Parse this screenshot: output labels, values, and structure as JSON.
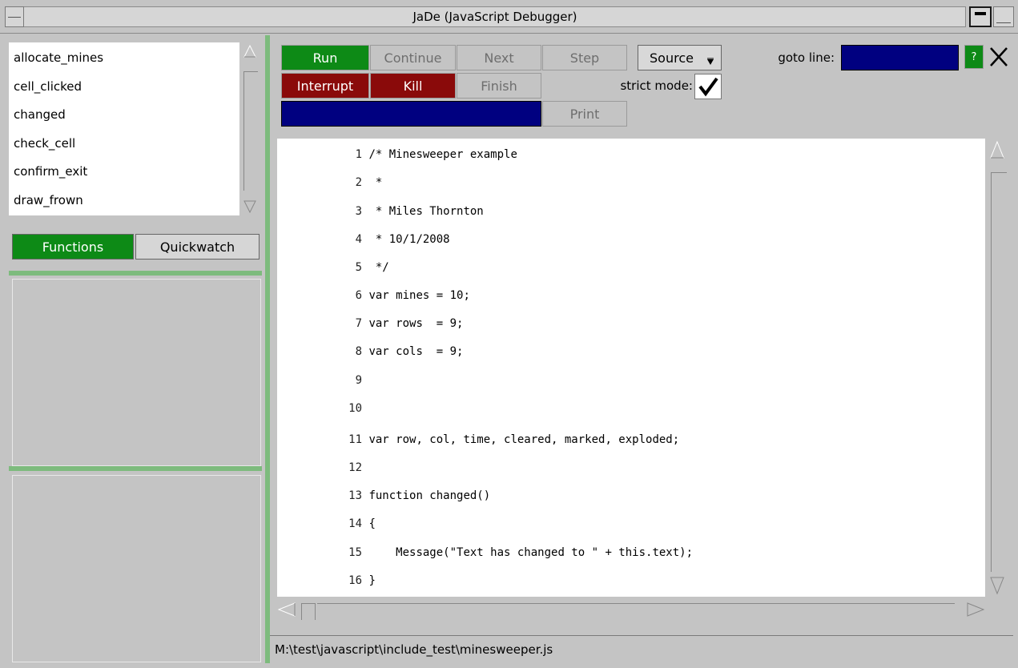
{
  "window": {
    "title": "JaDe (JavaScript Debugger)"
  },
  "functions_list": {
    "items": [
      "allocate_mines",
      "cell_clicked",
      "changed",
      "check_cell",
      "confirm_exit",
      "draw_frown"
    ]
  },
  "left_tabs": {
    "functions": "Functions",
    "quickwatch": "Quickwatch"
  },
  "toolbar": {
    "run": "Run",
    "continue": "Continue",
    "next": "Next",
    "step": "Step",
    "source": "Source",
    "goto_line_label": "goto line:",
    "goto_line_value": "",
    "help": "?",
    "interrupt": "Interrupt",
    "kill": "Kill",
    "finish": "Finish",
    "strict_mode_label": "strict mode:",
    "strict_mode_checked": true,
    "print_input_value": "",
    "print": "Print"
  },
  "code": {
    "lines": [
      {
        "n": "1",
        "text": "/* Minesweeper example"
      },
      {
        "n": "2",
        "text": " *"
      },
      {
        "n": "3",
        "text": " * Miles Thornton"
      },
      {
        "n": "4",
        "text": " * 10/1/2008"
      },
      {
        "n": "5",
        "text": " */"
      },
      {
        "n": "6",
        "text": "var mines = 10;"
      },
      {
        "n": "7",
        "text": "var rows  = 9;"
      },
      {
        "n": "8",
        "text": "var cols  = 9;"
      },
      {
        "n": "9",
        "text": ""
      },
      {
        "n": "10",
        "text": ""
      },
      {
        "n": "11",
        "text": "var row, col, time, cleared, marked, exploded;"
      },
      {
        "n": "12",
        "text": ""
      },
      {
        "n": "13",
        "text": "function changed()"
      },
      {
        "n": "14",
        "text": "{"
      },
      {
        "n": "15",
        "text": "    Message(\"Text has changed to \" + this.text);"
      },
      {
        "n": "16",
        "text": "}"
      }
    ]
  },
  "status": {
    "file_path": "M:\\test\\javascript\\include_test\\minesweeper.js"
  },
  "colors": {
    "green": "#0d8a16",
    "red": "#8a0a0a",
    "navy": "#000080",
    "panel": "#c4c4c4",
    "separator": "#7dbb7d"
  }
}
